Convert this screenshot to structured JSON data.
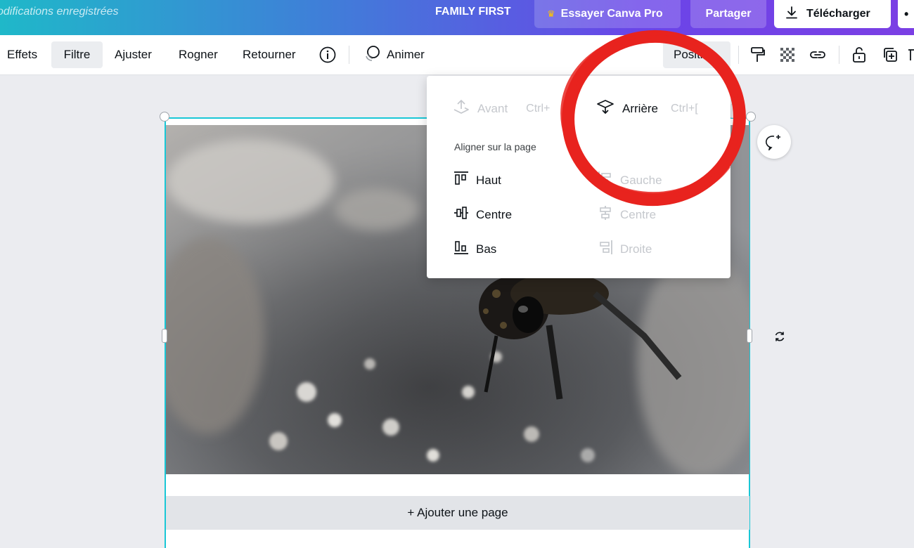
{
  "topbar": {
    "saved_status": "odifications enregistrées",
    "project_name": "FAMILY FIRST",
    "pro_button": "Essayer Canva Pro",
    "share_button": "Partager",
    "download_button": "Télécharger",
    "more_button": "•"
  },
  "toolbar": {
    "effects": "Effets",
    "filter": "Filtre",
    "adjust": "Ajuster",
    "crop": "Rogner",
    "flip": "Retourner",
    "animate": "Animer",
    "position": "Positi",
    "active_item": "Filtre"
  },
  "menu": {
    "forward_label": "Avant",
    "forward_shortcut": "Ctrl+",
    "backward_label": "Arrière",
    "backward_shortcut": "Ctrl+[",
    "align_title": "Aligner sur la page",
    "top": "Haut",
    "center_v": "Centre",
    "bottom": "Bas",
    "left": "Gauche",
    "center_h": "Centre",
    "right": "Droite"
  },
  "canvas": {
    "add_page": "+ Ajouter une page"
  },
  "colors": {
    "selection": "#19c7d6",
    "annotation": "#e8231e",
    "crown": "#ffc300"
  }
}
